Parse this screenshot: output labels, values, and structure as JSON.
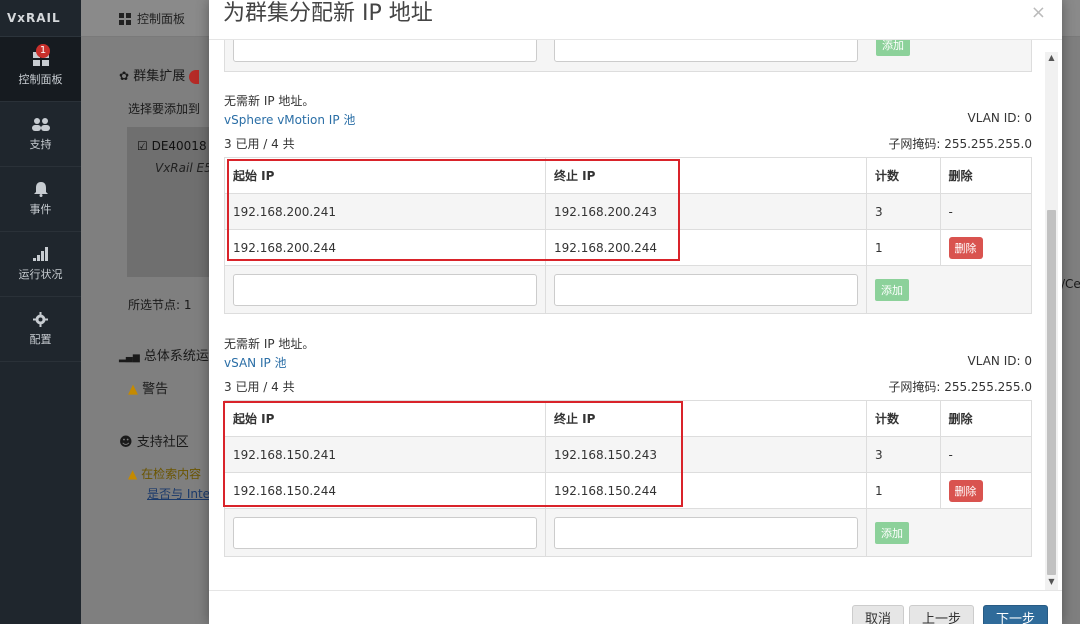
{
  "app": {
    "logo": "VxRAIL",
    "topbar_tab": "控制面板"
  },
  "sidebar": {
    "items": [
      {
        "label": "控制面板",
        "badge": "1",
        "icon": "dashboard-icon"
      },
      {
        "label": "支持",
        "icon": "users-icon"
      },
      {
        "label": "事件",
        "icon": "bell-icon"
      },
      {
        "label": "运行状况",
        "icon": "signal-icon"
      },
      {
        "label": "配置",
        "icon": "gear-icon"
      }
    ]
  },
  "background": {
    "expand_title": "群集扩展",
    "select_text": "选择要添加到",
    "node_name": "DE40018",
    "node_model": "VxRail E5",
    "selected_nodes": "所选节点: 1",
    "system_title": "总体系统运",
    "warning": "警告",
    "community_title": "支持社区",
    "search_warn": "在检索内容",
    "intel_link": "是否与 Inte",
    "right_edge": "/Ce"
  },
  "modal": {
    "title": "为群集分配新 IP 地址",
    "close": "×",
    "sections": [
      {
        "note": "无需新 IP 地址。",
        "pool_name": "vSphere vMotion IP 池",
        "usage": "3 已用 / 4 共",
        "vlan": "VLAN ID: 0",
        "mask": "子网掩码: 255.255.255.0",
        "headers": {
          "start": "起始 IP",
          "end": "终止 IP",
          "count": "计数",
          "delete": "删除"
        },
        "rows": [
          {
            "start": "192.168.200.241",
            "end": "192.168.200.243",
            "count": "3",
            "delete": "-"
          },
          {
            "start": "192.168.200.244",
            "end": "192.168.200.244",
            "count": "1",
            "delete": "删除"
          }
        ],
        "add_label": "添加"
      },
      {
        "note": "无需新 IP 地址。",
        "pool_name": "vSAN IP 池",
        "usage": "3 已用 / 4 共",
        "vlan": "VLAN ID: 0",
        "mask": "子网掩码: 255.255.255.0",
        "headers": {
          "start": "起始 IP",
          "end": "终止 IP",
          "count": "计数",
          "delete": "删除"
        },
        "rows": [
          {
            "start": "192.168.150.241",
            "end": "192.168.150.243",
            "count": "3",
            "delete": "-"
          },
          {
            "start": "192.168.150.244",
            "end": "192.168.150.244",
            "count": "1",
            "delete": "删除"
          }
        ],
        "add_label": "添加"
      }
    ],
    "top_partial_add": "添加",
    "footer": {
      "cancel": "取消",
      "prev": "上一步",
      "next": "下一步"
    }
  },
  "colors": {
    "sidebar_bg": "#1f262d",
    "link": "#2a6ea6",
    "delete_button": "#d9534f",
    "add_button": "#8cd19a",
    "highlight": "#d9232a",
    "primary": "#2f6b9a"
  }
}
